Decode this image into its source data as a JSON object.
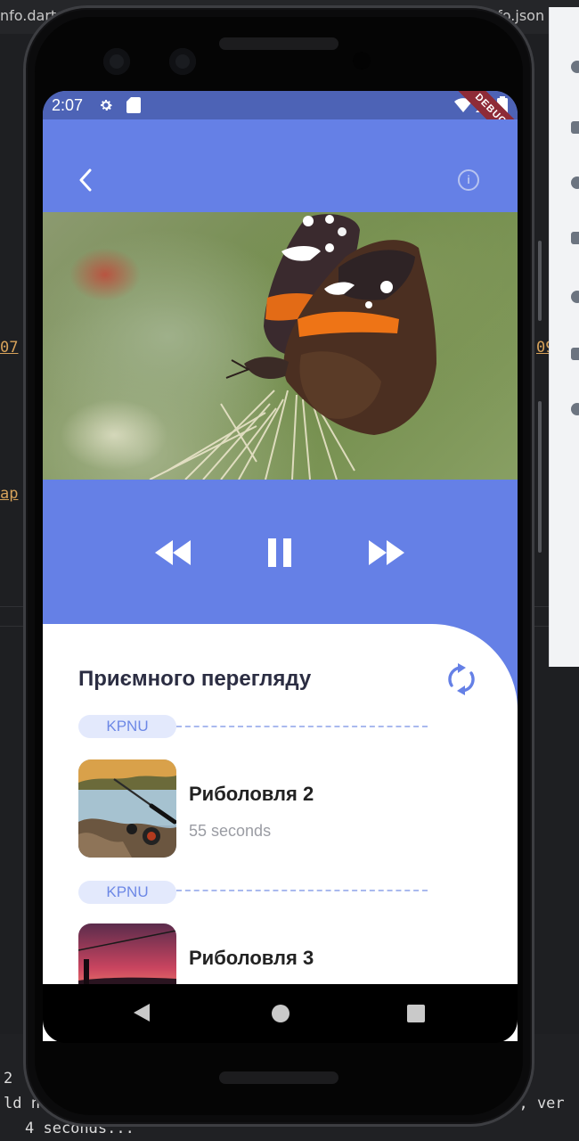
{
  "ide": {
    "tab_left": "nfo.dart",
    "tab_right": "nfo.json",
    "code_left_1": "07",
    "code_left_2": "ap",
    "code_right_1": "09",
    "terminal_line_1": "2",
    "terminal_line_2": "ld not",
    "terminal_line_3": "4 seconds...",
    "terminal_right": "g), ver"
  },
  "status_bar": {
    "time": "2:07",
    "debug_banner": "DEBUG"
  },
  "app_bar": {
    "back_icon": "chevron-left-icon",
    "info_icon": "info-icon",
    "info_glyph": "i"
  },
  "player": {
    "rewind_icon": "rewind-icon",
    "pause_icon": "pause-icon",
    "forward_icon": "fast-forward-icon"
  },
  "playlist": {
    "title": "Приємного перегляду",
    "refresh_icon": "refresh-icon",
    "items": [
      {
        "group": "KPNU",
        "title": "Риболовля 2",
        "duration": "55 seconds"
      },
      {
        "group": "KPNU",
        "title": "Риболовля 3",
        "duration": ""
      }
    ]
  },
  "colors": {
    "accent": "#6580E6",
    "status_bar": "#4D63B6",
    "chip_bg": "#E3E9FC",
    "chip_text": "#6D88E6",
    "debug": "#8E2B37"
  }
}
